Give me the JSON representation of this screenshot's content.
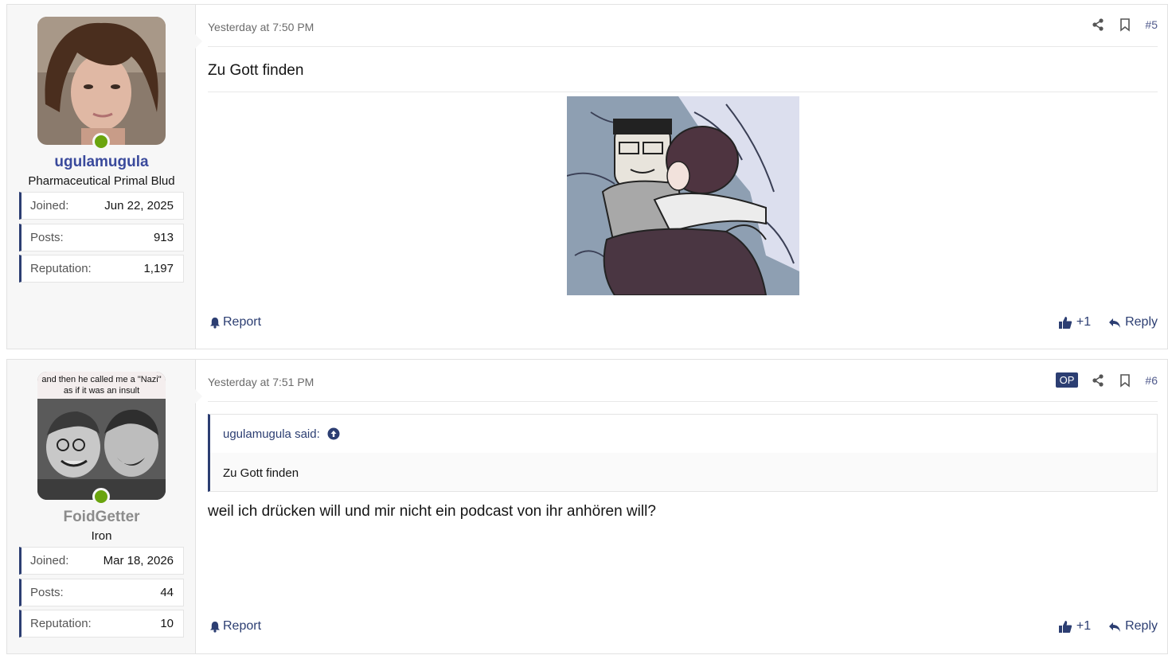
{
  "posts": [
    {
      "user": {
        "name": "ugulamugula",
        "title": "Pharmaceutical Primal Blud",
        "stats": [
          {
            "label": "Joined:",
            "value": "Jun 22, 2025"
          },
          {
            "label": "Posts:",
            "value": "913"
          },
          {
            "label": "Reputation:",
            "value": "1,197"
          }
        ]
      },
      "time": "Yesterday at 7:50 PM",
      "number": "#5",
      "text": "Zu Gott finden",
      "footer": {
        "report": "Report",
        "like": "+1",
        "reply": "Reply"
      }
    },
    {
      "user": {
        "name": "FoidGetter",
        "title": "Iron",
        "avatar_caption_1": "and then he called me a \"Nazi\"",
        "avatar_caption_2": "as if it was an insult",
        "stats": [
          {
            "label": "Joined:",
            "value": "Mar 18, 2026"
          },
          {
            "label": "Posts:",
            "value": "44"
          },
          {
            "label": "Reputation:",
            "value": "10"
          }
        ]
      },
      "time": "Yesterday at 7:51 PM",
      "op_badge": "OP",
      "number": "#6",
      "quote": {
        "author": "ugulamugula said:",
        "text": "Zu Gott finden"
      },
      "text": "weil ich drücken will und mir nicht ein podcast von ihr anhören will?",
      "footer": {
        "report": "Report",
        "like": "+1",
        "reply": "Reply"
      }
    }
  ],
  "colors": {
    "accent": "#2c3e72",
    "online": "#6aa40e",
    "username": "#3a4a9c"
  }
}
